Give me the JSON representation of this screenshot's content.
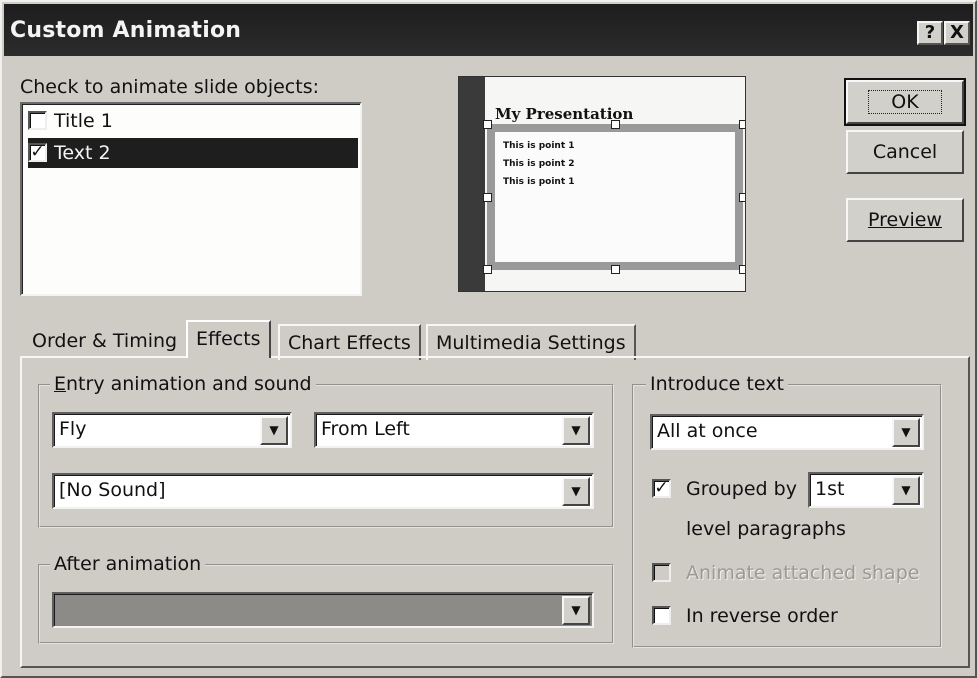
{
  "window": {
    "title": "Custom Animation",
    "help_label": "?",
    "close_label": "X"
  },
  "objects": {
    "label": "Check to animate slide objects:",
    "items": [
      {
        "label": "Title 1",
        "checked": false,
        "selected": false
      },
      {
        "label": "Text 2",
        "checked": true,
        "selected": true
      }
    ]
  },
  "preview": {
    "title": "My Presentation",
    "bullets": [
      "This is point 1",
      "This is point 2",
      "This is point 1"
    ]
  },
  "buttons": {
    "ok": "OK",
    "cancel": "Cancel",
    "preview": "Preview"
  },
  "tabs": [
    "Order & Timing",
    "Effects",
    "Chart Effects",
    "Multimedia Settings"
  ],
  "active_tab": "Effects",
  "entry": {
    "legend": "Entry animation and sound",
    "effect": "Fly",
    "direction": "From Left",
    "sound": "[No Sound]"
  },
  "after": {
    "legend": "After animation",
    "value": ""
  },
  "introduce": {
    "legend": "Introduce text",
    "value": "All at once",
    "grouped_by_label": "Grouped by",
    "grouped_by_checked": true,
    "grouped_by_value": "1st",
    "level_label": "level paragraphs",
    "animate_shape_label": "Animate attached shape",
    "animate_shape_checked": false,
    "reverse_label": "In reverse order",
    "reverse_checked": false
  },
  "glyphs": {
    "check": "✓",
    "dropdown": "▼"
  }
}
